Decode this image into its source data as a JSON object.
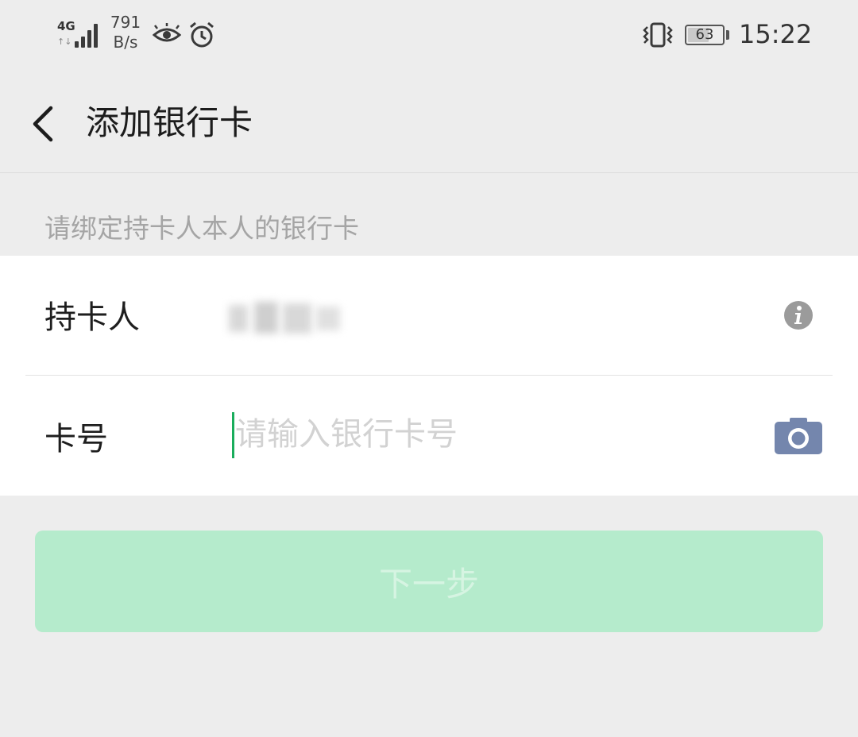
{
  "status_bar": {
    "network_type": "4G",
    "network_arrows": "↑↓",
    "speed_value": "791",
    "speed_unit": "B/s",
    "battery_level": 0.63,
    "battery_text": "63",
    "time": "15:22"
  },
  "nav": {
    "back_icon": "chevron-left-icon",
    "title": "添加银行卡"
  },
  "hint": "请绑定持卡人本人的银行卡",
  "form": {
    "holder_label": "持卡人",
    "holder_value_state": "blurred",
    "holder_info_icon": "info-icon",
    "card_label": "卡号",
    "card_placeholder": "请输入银行卡号",
    "card_value": "",
    "camera_icon": "camera-icon"
  },
  "next_button": {
    "label": "下一步",
    "state": "disabled"
  },
  "colors": {
    "background": "#ededed",
    "card": "#ffffff",
    "caret": "#1aad5c",
    "button_disabled": "#b5ebcc",
    "camera": "#7486ad",
    "info": "#9b9b9b"
  }
}
